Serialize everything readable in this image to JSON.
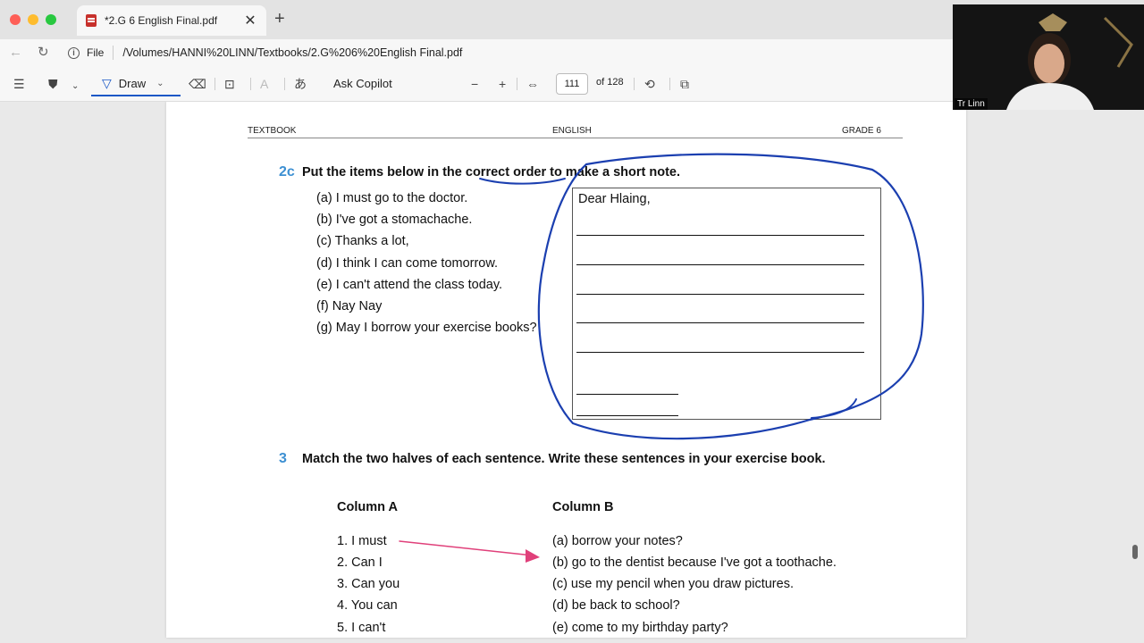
{
  "tab": {
    "title": "*2.G 6 English Final.pdf",
    "close": "✕",
    "new": "+"
  },
  "address": {
    "scheme": "File",
    "path": "/Volumes/HANNI%20LINN/Textbooks/2.G%206%20English Final.pdf"
  },
  "toolbar": {
    "draw_label": "Draw",
    "copilot_label": "Ask Copilot",
    "zoom_out": "−",
    "zoom_in": "+",
    "page_current": "111",
    "page_of": "of 128"
  },
  "page": {
    "header": {
      "left": "TEXTBOOK",
      "center": "ENGLISH",
      "right": "GRADE 6"
    },
    "q2c": {
      "number": "2c",
      "instruction": "Put the items below in the correct order to make a short note.",
      "items": [
        "(a) I must go to the doctor.",
        "(b) I've got a stomachache.",
        "(c) Thanks a lot,",
        "(d) I think I can come tomorrow.",
        "(e) I can't attend the class today.",
        "(f) Nay Nay",
        "(g) May I borrow your exercise books?"
      ],
      "note_greeting": "Dear Hlaing,"
    },
    "q3": {
      "number": "3",
      "instruction": "Match the two halves of each sentence. Write these sentences in your exercise book.",
      "column_a_title": "Column A",
      "column_b_title": "Column B",
      "column_a": [
        "1. I must",
        "2. Can I",
        "3. Can you",
        "4. You can",
        "5. I can't"
      ],
      "column_b": [
        "(a) borrow your notes?",
        "(b) go to the dentist because I've got a toothache.",
        "(c) use my pencil when you draw pictures.",
        "(d) be back to school?",
        "(e) come to my birthday party?"
      ]
    }
  },
  "webcam": {
    "name": "Tr Linn"
  },
  "colors": {
    "accent": "#1a58c6",
    "ink_blue": "#1b3fb0",
    "ink_pink": "#e0407a",
    "question_number": "#3c8fd2"
  }
}
